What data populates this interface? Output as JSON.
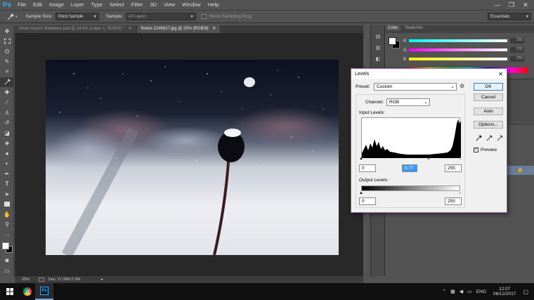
{
  "menubar": {
    "logo": "Ps",
    "items": [
      "File",
      "Edit",
      "Image",
      "Layer",
      "Type",
      "Select",
      "Filter",
      "3D",
      "View",
      "Window",
      "Help"
    ],
    "controls": [
      "—",
      "❐",
      "✕"
    ]
  },
  "options": {
    "sample_size_label": "Sample Size:",
    "sample_size_value": "Point Sample",
    "sample_label": "Sample:",
    "sample_value": "All Layers",
    "show_ring_label": "Show Sampling Ring",
    "workspace_value": "Essentials"
  },
  "tabs": [
    {
      "label": "Snow Scene Sleekless.psd @ 24.6% (Layer 1, RGB/8) *",
      "active": false
    },
    {
      "label": "flower-2146627.jpg @ 25% (RGB/8)",
      "active": true
    }
  ],
  "status": {
    "zoom": "25%",
    "doc": "Doc: 17.2M/17.2M"
  },
  "panels": {
    "color_tab": "Color",
    "swatches_tab": "Swatches",
    "slider_labels": [
      "R",
      "G",
      "B"
    ],
    "slider_values": [
      "255",
      "255",
      "255"
    ]
  },
  "levels": {
    "title": "Levels",
    "close": "✕",
    "preset_label": "Preset:",
    "preset_value": "Custom",
    "channel_label": "Channel:",
    "channel_value": "RGB",
    "input_label": "Input Levels:",
    "input_black": "0",
    "input_gamma": "0.77",
    "input_white": "255",
    "output_label": "Output Levels:",
    "output_black": "0",
    "output_white": "255",
    "ok": "OK",
    "cancel": "Cancel",
    "auto": "Auto",
    "options": "Options...",
    "preview_label": "Preview",
    "preview_checked": true
  },
  "taskbar": {
    "lang": "ENG",
    "time": "12:07",
    "date": "06/12/2017"
  }
}
